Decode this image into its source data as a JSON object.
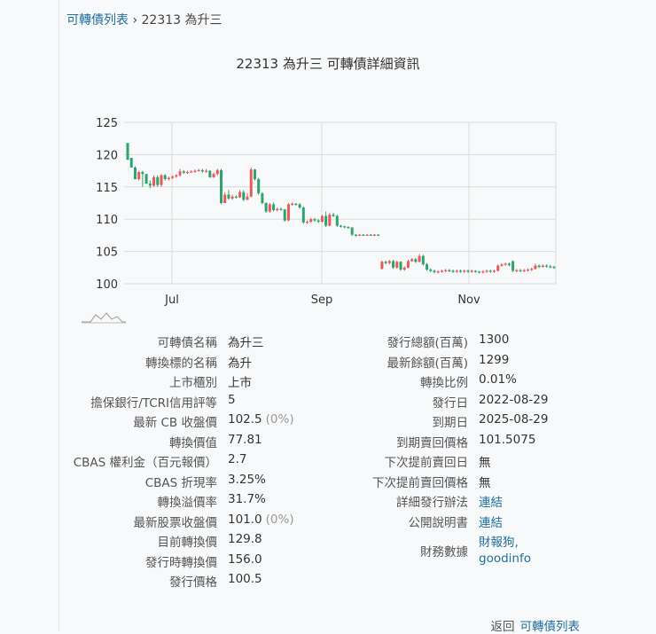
{
  "breadcrumb": {
    "parent": "可轉債列表",
    "separator": "›",
    "current": "22313 為升三"
  },
  "page_title": "22313 為升三 可轉債詳細資訊",
  "chart_data": {
    "type": "candlestick",
    "title": "",
    "x_ticks": [
      "Jul",
      "Sep",
      "Nov"
    ],
    "y_ticks": [
      100,
      105,
      110,
      115,
      120,
      125
    ],
    "ylim": [
      99.5,
      126
    ],
    "grid": true,
    "colors": {
      "up": "#e8595a",
      "down": "#2ea36b"
    },
    "candles": [
      [
        0,
        121.8,
        119.2,
        121.8,
        119.2
      ],
      [
        1,
        119.5,
        118.0,
        119.5,
        118.0
      ],
      [
        2,
        118.0,
        116.2,
        118.2,
        116.2
      ],
      [
        3,
        116.2,
        117.3,
        117.5,
        116.0
      ],
      [
        4,
        117.3,
        117.0,
        117.5,
        115.0
      ],
      [
        5,
        117.0,
        115.5,
        117.0,
        115.5
      ],
      [
        6,
        115.5,
        115.2,
        116.0,
        114.8
      ],
      [
        7,
        115.2,
        116.5,
        116.8,
        115.0
      ],
      [
        8,
        116.5,
        115.3,
        116.8,
        115.0
      ],
      [
        9,
        115.3,
        116.8,
        117.0,
        115.0
      ],
      [
        10,
        116.8,
        116.2,
        117.0,
        116.0
      ],
      [
        11,
        116.2,
        116.4,
        116.6,
        116.0
      ],
      [
        12,
        116.4,
        116.6,
        116.8,
        116.2
      ],
      [
        13,
        116.6,
        116.8,
        117.0,
        116.4
      ],
      [
        14,
        116.8,
        117.4,
        117.8,
        116.6
      ],
      [
        15,
        117.4,
        117.2,
        117.6,
        117.0
      ],
      [
        16,
        117.2,
        117.3,
        117.5,
        117.0
      ],
      [
        17,
        117.3,
        117.4,
        117.6,
        117.2
      ],
      [
        18,
        117.4,
        117.5,
        117.7,
        117.2
      ],
      [
        19,
        117.5,
        117.6,
        117.8,
        117.4
      ],
      [
        20,
        117.6,
        117.4,
        117.8,
        117.2
      ],
      [
        21,
        117.4,
        117.5,
        117.8,
        117.2
      ],
      [
        22,
        117.5,
        116.5,
        117.6,
        116.4
      ],
      [
        23,
        116.5,
        117.0,
        117.2,
        116.4
      ],
      [
        24,
        117.0,
        117.6,
        117.8,
        116.8
      ],
      [
        25,
        117.6,
        112.5,
        117.8,
        112.3
      ],
      [
        26,
        112.5,
        113.8,
        114.2,
        112.8
      ],
      [
        27,
        113.8,
        113.2,
        114.5,
        113.0
      ],
      [
        28,
        113.2,
        113.5,
        113.8,
        113.0
      ],
      [
        29,
        113.5,
        113.4,
        113.7,
        113.2
      ],
      [
        30,
        113.4,
        114.2,
        114.5,
        113.3
      ],
      [
        31,
        114.2,
        113.0,
        114.5,
        112.8
      ],
      [
        32,
        113.0,
        113.5,
        114.0,
        113.0
      ],
      [
        33,
        113.5,
        117.7,
        118.0,
        113.4
      ],
      [
        34,
        117.7,
        116.2,
        117.8,
        116.0
      ],
      [
        35,
        116.2,
        114.0,
        116.4,
        113.8
      ],
      [
        36,
        114.0,
        112.5,
        114.2,
        112.3
      ],
      [
        37,
        112.5,
        111.2,
        112.6,
        111.0
      ],
      [
        38,
        111.2,
        112.3,
        112.5,
        111.0
      ],
      [
        39,
        112.3,
        111.4,
        112.6,
        111.2
      ],
      [
        40,
        111.4,
        111.6,
        111.8,
        111.2
      ],
      [
        41,
        111.6,
        111.5,
        111.8,
        111.3
      ],
      [
        42,
        111.5,
        109.8,
        111.6,
        109.6
      ],
      [
        43,
        109.8,
        112.3,
        112.5,
        109.7
      ],
      [
        44,
        112.3,
        112.4,
        112.6,
        112.1
      ],
      [
        45,
        112.4,
        112.3,
        112.5,
        112.1
      ],
      [
        46,
        112.3,
        111.8,
        112.5,
        111.6
      ],
      [
        47,
        111.8,
        109.5,
        112.0,
        109.3
      ],
      [
        48,
        109.5,
        109.6,
        109.8,
        109.3
      ],
      [
        49,
        109.6,
        110.0,
        110.2,
        109.4
      ],
      [
        50,
        110.0,
        109.8,
        110.2,
        109.6
      ],
      [
        51,
        109.8,
        109.6,
        110.0,
        109.4
      ],
      [
        52,
        109.6,
        110.5,
        110.7,
        109.5
      ],
      [
        53,
        110.5,
        109.0,
        111.2,
        108.8
      ],
      [
        54,
        109.0,
        110.7,
        111.0,
        108.9
      ],
      [
        55,
        110.7,
        110.5,
        111.0,
        110.3
      ],
      [
        56,
        110.5,
        109.0,
        110.7,
        108.8
      ],
      [
        57,
        109.0,
        108.9,
        109.1,
        108.7
      ],
      [
        58,
        108.9,
        108.8,
        109.0,
        108.6
      ],
      [
        59,
        108.8,
        108.7,
        108.9,
        108.5
      ],
      [
        60,
        108.7,
        107.6,
        108.8,
        107.4
      ],
      [
        61,
        107.6,
        107.5,
        107.7,
        107.3
      ],
      [
        62,
        107.5,
        107.6,
        107.7,
        107.4
      ],
      [
        63,
        107.6,
        107.5,
        107.7,
        107.4
      ],
      [
        64,
        107.5,
        107.6,
        107.7,
        107.4
      ],
      [
        65,
        107.6,
        107.5,
        107.7,
        107.4
      ],
      [
        66,
        107.5,
        107.6,
        107.7,
        107.4
      ],
      [
        67,
        107.6,
        107.5,
        107.7,
        107.4
      ],
      [
        68,
        102.3,
        103.4,
        103.6,
        102.2
      ],
      [
        69,
        103.4,
        103.2,
        103.6,
        103.0
      ],
      [
        70,
        103.2,
        103.5,
        103.7,
        103.0
      ],
      [
        71,
        103.5,
        102.5,
        103.7,
        102.3
      ],
      [
        72,
        102.5,
        103.4,
        103.6,
        102.3
      ],
      [
        73,
        103.4,
        102.2,
        103.5,
        102.0
      ],
      [
        74,
        102.2,
        102.5,
        102.7,
        102.0
      ],
      [
        75,
        102.5,
        103.5,
        103.7,
        102.4
      ],
      [
        76,
        103.5,
        103.8,
        104.0,
        103.4
      ],
      [
        77,
        103.8,
        103.4,
        104.0,
        103.2
      ],
      [
        78,
        103.4,
        104.3,
        104.6,
        103.3
      ],
      [
        79,
        104.3,
        103.0,
        104.5,
        102.8
      ],
      [
        80,
        103.0,
        102.2,
        103.2,
        102.0
      ],
      [
        81,
        102.2,
        102.0,
        102.4,
        101.8
      ],
      [
        82,
        102.0,
        101.8,
        102.2,
        101.6
      ],
      [
        83,
        101.8,
        101.9,
        102.1,
        101.6
      ],
      [
        84,
        101.9,
        102.0,
        102.2,
        101.7
      ],
      [
        85,
        102.0,
        102.1,
        102.3,
        101.8
      ],
      [
        86,
        102.1,
        102.0,
        102.3,
        101.8
      ],
      [
        87,
        102.0,
        101.9,
        102.2,
        101.7
      ],
      [
        88,
        101.9,
        102.0,
        102.2,
        101.7
      ],
      [
        89,
        102.0,
        101.9,
        102.2,
        101.7
      ],
      [
        90,
        101.9,
        102.0,
        102.2,
        101.7
      ],
      [
        91,
        102.0,
        101.9,
        102.2,
        101.7
      ],
      [
        92,
        101.9,
        102.0,
        102.2,
        101.7
      ],
      [
        93,
        102.0,
        101.9,
        102.1,
        101.7
      ],
      [
        94,
        101.9,
        101.8,
        102.0,
        101.6
      ],
      [
        95,
        101.8,
        101.9,
        102.1,
        101.6
      ],
      [
        96,
        101.9,
        102.0,
        102.2,
        101.7
      ],
      [
        97,
        102.0,
        101.9,
        102.2,
        101.7
      ],
      [
        98,
        101.9,
        102.0,
        102.2,
        101.7
      ],
      [
        99,
        102.0,
        102.8,
        103.0,
        101.9
      ],
      [
        100,
        102.8,
        103.0,
        103.2,
        102.6
      ],
      [
        101,
        103.0,
        103.1,
        103.3,
        102.8
      ],
      [
        102,
        103.1,
        102.9,
        103.3,
        102.7
      ],
      [
        103,
        103.5,
        102.0,
        103.6,
        101.8
      ],
      [
        104,
        102.0,
        102.1,
        102.3,
        101.8
      ],
      [
        105,
        102.1,
        102.0,
        102.3,
        101.8
      ],
      [
        106,
        102.0,
        102.1,
        102.3,
        101.8
      ],
      [
        107,
        102.1,
        102.2,
        102.4,
        101.9
      ],
      [
        108,
        102.2,
        102.3,
        102.5,
        102.0
      ],
      [
        109,
        102.3,
        102.8,
        103.1,
        102.2
      ],
      [
        110,
        102.8,
        102.6,
        103.0,
        102.4
      ],
      [
        111,
        102.6,
        102.8,
        103.0,
        102.5
      ],
      [
        112,
        102.8,
        102.7,
        103.0,
        102.5
      ],
      [
        113,
        102.7,
        102.6,
        102.9,
        102.4
      ],
      [
        114,
        102.6,
        102.5,
        102.8,
        102.3
      ]
    ]
  },
  "info_left": [
    {
      "label": "可轉債名稱",
      "value": "為升三"
    },
    {
      "label": "轉換標的名稱",
      "value": "為升"
    },
    {
      "label": "上市櫃別",
      "value": "上市"
    },
    {
      "label": "擔保銀行/TCRI信用評等",
      "value": "5"
    },
    {
      "label": "最新 CB 收盤價",
      "value": "102.5",
      "sub": "(0%)"
    },
    {
      "label": "轉換價值",
      "value": "77.81"
    },
    {
      "label": "CBAS 權利金（百元報價）",
      "value": "2.7"
    },
    {
      "label": "CBAS 折現率",
      "value": "3.25%"
    },
    {
      "label": "轉換溢價率",
      "value": "31.7%"
    },
    {
      "label": "最新股票收盤價",
      "value": "101.0",
      "sub": "(0%)"
    },
    {
      "label": "目前轉換價",
      "value": "129.8"
    },
    {
      "label": "發行時轉換價",
      "value": "156.0"
    },
    {
      "label": "發行價格",
      "value": "100.5"
    }
  ],
  "info_right": [
    {
      "label": "發行總額(百萬)",
      "value": "1300"
    },
    {
      "label": "最新餘額(百萬)",
      "value": "1299"
    },
    {
      "label": "轉換比例",
      "value": "0.01%"
    },
    {
      "label": "發行日",
      "value": "2022-08-29"
    },
    {
      "label": "到期日",
      "value": "2025-08-29"
    },
    {
      "label": "到期賣回價格",
      "value": "101.5075"
    },
    {
      "label": "下次提前賣回日",
      "value": "無"
    },
    {
      "label": "下次提前賣回價格",
      "value": "無"
    },
    {
      "label": "詳細發行辦法",
      "value": "連結",
      "link": true
    },
    {
      "label": "公開說明書",
      "value": "連結",
      "link": true
    },
    {
      "label": "財務數據",
      "value": "財報狗,",
      "value2": "goodinfo",
      "link": true
    }
  ],
  "footer": {
    "prefix": "返回",
    "link": "可轉債列表"
  }
}
